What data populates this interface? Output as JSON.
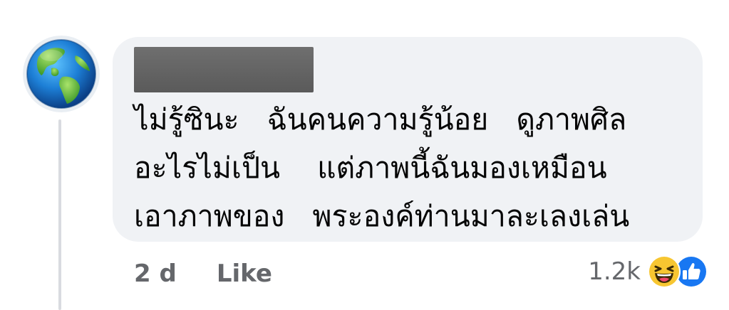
{
  "comment": {
    "avatar_icon": "globe-icon",
    "author_name": "",
    "lines": [
      "ไม่รู้ซินะ   ฉันคนความรู้น้อย   ดูภาพศิล",
      "อะไรไม่เป็น    แต่ภาพนี้ฉันมองเหมือน",
      "เอาภาพของ   พระองค์ท่านมาละเลงเล่น"
    ],
    "text": "ไม่รู้ซินะ   ฉันคนความรู้น้อย   ดูภาพศิล\nอะไรไม่เป็น    แต่ภาพนี้ฉันมองเหมือน\nเอาภาพของ   พระองค์ท่านมาละเลงเล่น"
  },
  "actions": {
    "time": "2 d",
    "like_label": "Like"
  },
  "reactions": {
    "count": "1.2k",
    "icons": [
      "haha-icon",
      "like-icon"
    ]
  },
  "colors": {
    "bubble": "#f0f2f5",
    "meta_text": "#65676b",
    "like_blue": "#1877f2",
    "haha_yellow": "#f7c631"
  }
}
